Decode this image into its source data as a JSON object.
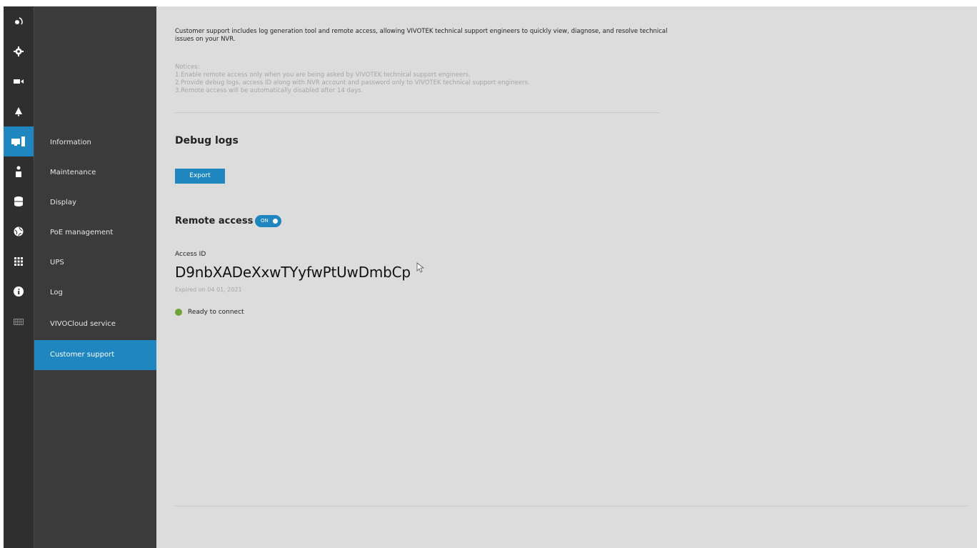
{
  "sidebar": {
    "icons": [
      {
        "name": "camera-rotate-icon"
      },
      {
        "name": "gear-icon"
      },
      {
        "name": "video-camera-icon"
      },
      {
        "name": "bell-icon"
      },
      {
        "name": "system-icon",
        "active": true
      },
      {
        "name": "user-icon"
      },
      {
        "name": "database-icon"
      },
      {
        "name": "network-globe-icon"
      },
      {
        "name": "apps-grid-icon"
      },
      {
        "name": "info-icon"
      },
      {
        "name": "keyboard-icon"
      }
    ],
    "menu": [
      {
        "label": "Information"
      },
      {
        "label": "Maintenance"
      },
      {
        "label": "Display"
      },
      {
        "label": "PoE management"
      },
      {
        "label": "UPS"
      },
      {
        "label": "Log"
      },
      {
        "label": "VIVOCloud service"
      },
      {
        "label": "Customer support",
        "active": true
      }
    ]
  },
  "main": {
    "intro": "Customer support includes log generation tool and remote access, allowing VIVOTEK technical support engineers to quickly view, diagnose, and resolve technical issues on your NVR.",
    "notices": {
      "title": "Notices:",
      "items": [
        "1.Enable remote access only when you are being asked by VIVOTEK technical support engineers.",
        "2.Provide debug logs, access ID along with NVR account and password only to VIVOTEK technical support engineers.",
        "3.Remote access will be automatically disabled after 14 days."
      ]
    },
    "debug": {
      "heading": "Debug logs",
      "export_label": "Export"
    },
    "remote": {
      "heading": "Remote access",
      "toggle_label": "ON",
      "access_label": "Access ID",
      "access_id": "D9nbXADeXxwTYyfwPtUwDmbCp",
      "expired": "Expired on 04 01, 2021",
      "status": "Ready to connect"
    }
  },
  "colors": {
    "accent": "#1f86c0",
    "status_ok": "#6ea339",
    "iconbar_bg": "#2f2f2f",
    "subnav_bg": "#3b3b3b",
    "content_bg": "#dcdcdc"
  }
}
